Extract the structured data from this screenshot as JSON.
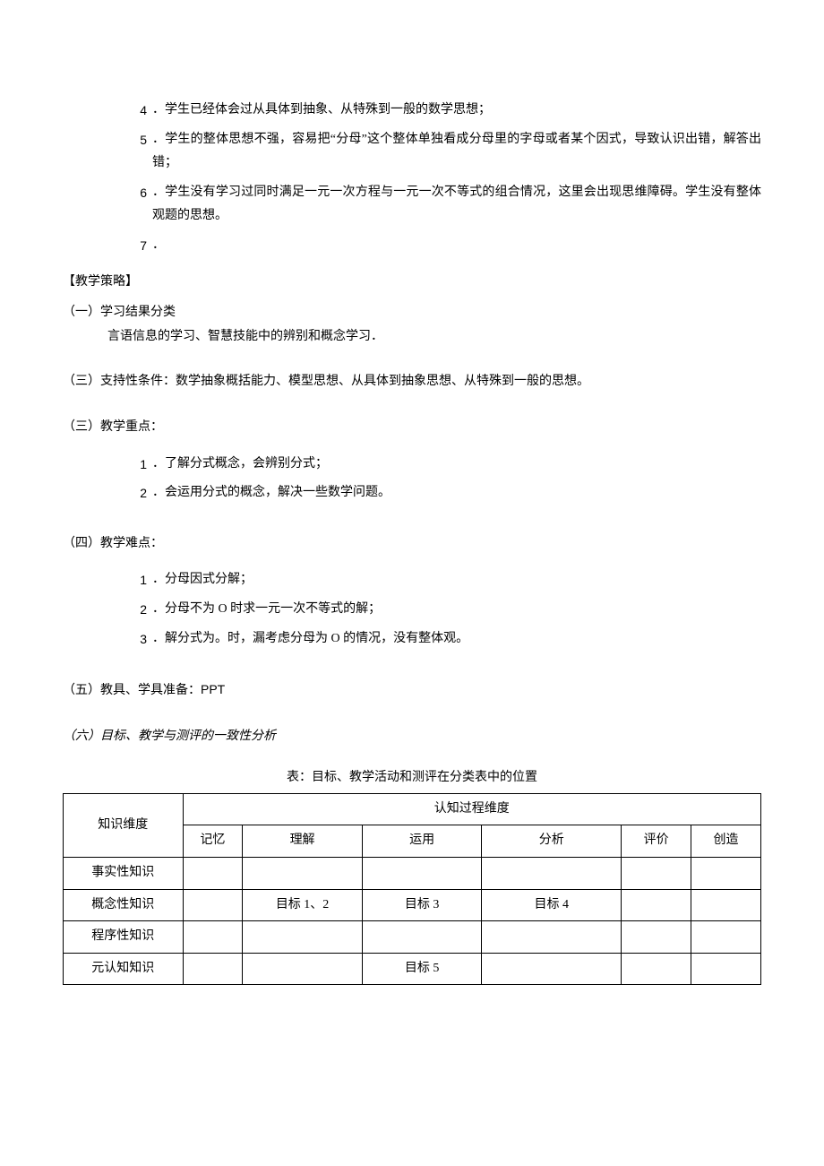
{
  "items_top": [
    {
      "num": "4",
      "text": "．学生已经体会过从具体到抽象、从特殊到一般的数学思想；"
    },
    {
      "num": "5",
      "text": "．学生的整体思想不强，容易把“分母”这个整体单独看成分母里的字母或者某个因式，导致认识出错，解答出错；"
    },
    {
      "num": "6",
      "text": "．学生没有学习过同时满足一元一次方程与一元一次不等式的组合情况，这里会出现思维障碍。学生没有整体观题的思想。"
    },
    {
      "num": "7",
      "text": "．"
    }
  ],
  "strategy_header": "【教学策略】",
  "section1": {
    "heading": "（一）学习结果分类",
    "body": "言语信息的学习、智慧技能中的辨别和概念学习．"
  },
  "section2": {
    "heading": "（三）支持性条件：数学抽象概括能力、模型思想、从具体到抽象思想、从特殊到一般的思想。"
  },
  "section3": {
    "heading": "（三）教学重点：",
    "items": [
      {
        "num": "1",
        "text": "．了解分式概念，会辨别分式；"
      },
      {
        "num": "2",
        "text": "．会运用分式的概念，解决一些数学问题。"
      }
    ]
  },
  "section4": {
    "heading": "（四）教学难点：",
    "items": [
      {
        "num": "1",
        "text": "．分母因式分解；"
      },
      {
        "num": "2",
        "text": "．分母不为 O 时求一元一次不等式的解；"
      },
      {
        "num": "3",
        "text": "．解分式为。时，漏考虑分母为 O 的情况，没有整体观。"
      }
    ]
  },
  "section5": {
    "heading_prefix": "（五）教具、学具准备：",
    "heading_suffix": "PPT"
  },
  "section6": {
    "heading": "（六）目标、教学与测评的一致性分析"
  },
  "table_caption": "表：目标、教学活动和测评在分类表中的位置",
  "table": {
    "row_header": "知识维度",
    "col_header": "认知过程维度",
    "cols": [
      "记忆",
      "理解",
      "运用",
      "分析",
      "评价",
      "创造"
    ],
    "rows": [
      {
        "label": "事实性知识",
        "cells": [
          "",
          "",
          "",
          "",
          "",
          ""
        ]
      },
      {
        "label": "概念性知识",
        "cells": [
          "",
          "目标 1、2",
          "目标 3",
          "目标 4",
          "",
          ""
        ]
      },
      {
        "label": "程序性知识",
        "cells": [
          "",
          "",
          "",
          "",
          "",
          ""
        ]
      },
      {
        "label": "元认知知识",
        "cells": [
          "",
          "",
          "目标 5",
          "",
          "",
          ""
        ]
      }
    ]
  }
}
